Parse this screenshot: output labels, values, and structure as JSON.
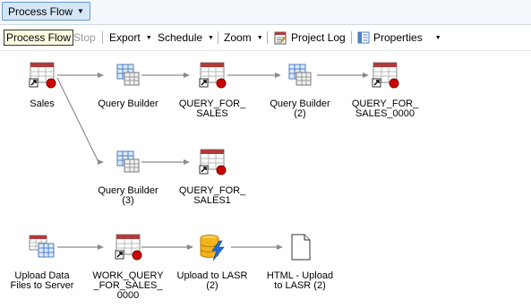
{
  "tab": {
    "label": "Process Flow"
  },
  "toolbar": {
    "process_flow": "Process Flow",
    "stop": "Stop",
    "export": "Export",
    "schedule": "Schedule",
    "zoom": "Zoom",
    "project_log": "Project Log",
    "properties": "Properties"
  },
  "nodes": {
    "sales": "Sales",
    "qb1": "Query Builder",
    "qfs": "QUERY_FOR_\nSALES",
    "qb2": "Query Builder\n(2)",
    "qfs0000": "QUERY_FOR_\nSALES_0000",
    "qb3": "Query Builder\n(3)",
    "qfs1": "QUERY_FOR_\nSALES1",
    "upload": "Upload Data\nFiles to Server",
    "work": "WORK_QUERY\n_FOR_SALES_\n0000",
    "lasr": "Upload to LASR\n(2)",
    "html": "HTML - Upload\nto LASR (2)"
  },
  "colors": {
    "accent": "#6b9bd1",
    "table_header": "#b23a3a",
    "query_grid": "#4a7fc4",
    "status_dot": "#cc0000",
    "lasr_cylinder": "#f2b41c",
    "lightning": "#1e6fd9",
    "connector": "#8a8a8a"
  }
}
